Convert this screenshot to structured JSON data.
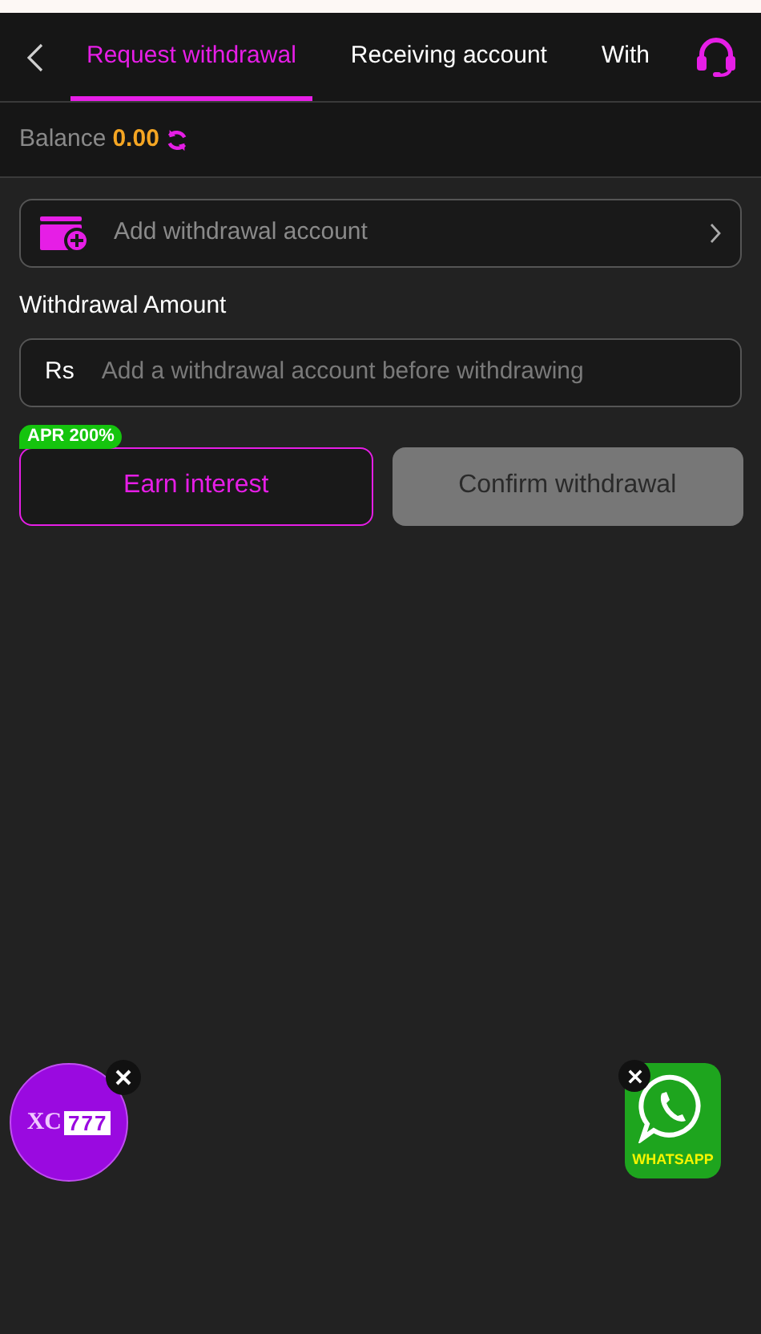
{
  "header": {
    "tabs": [
      {
        "label": "Request withdrawal",
        "selected": true
      },
      {
        "label": "Receiving account",
        "selected": false
      },
      {
        "label": "With",
        "selected": false
      }
    ]
  },
  "balance": {
    "label": "Balance",
    "amount": "0.00"
  },
  "account_row": {
    "label": "Add withdrawal account"
  },
  "amount": {
    "label": "Withdrawal Amount",
    "currency": "Rs",
    "placeholder": "Add a withdrawal account before withdrawing"
  },
  "badge": "APR 200%",
  "buttons": [
    {
      "label": "Earn interest",
      "disabled": false,
      "kind": "outline"
    },
    {
      "label": "Confirm withdrawal",
      "disabled": true,
      "kind": "filled"
    }
  ],
  "floating": {
    "left": {
      "brand": "XC",
      "digits": "777"
    },
    "right": {
      "label": "WHATSAPP"
    }
  }
}
